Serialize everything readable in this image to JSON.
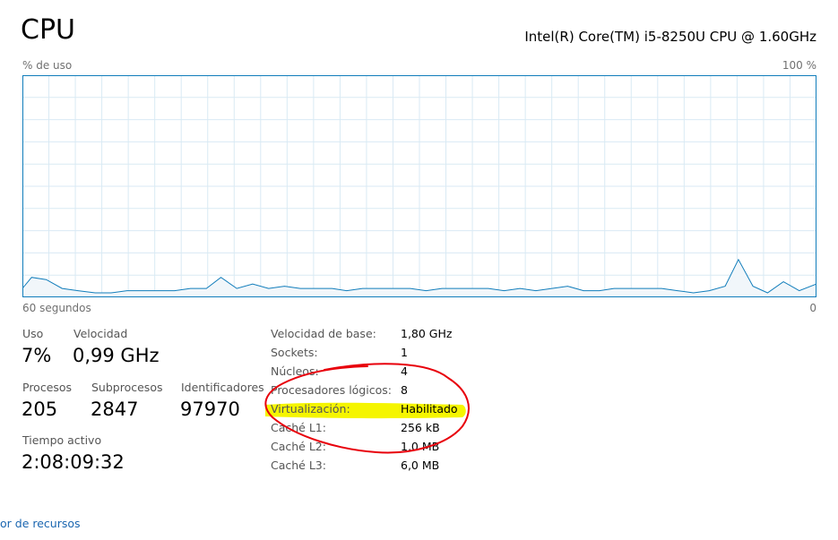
{
  "header": {
    "title": "CPU",
    "cpu_model": "Intel(R) Core(TM) i5-8250U CPU @ 1.60GHz"
  },
  "graph": {
    "y_label": "% de uso",
    "y_max_label": "100 %",
    "x_left_label": "60 segundos",
    "x_right_label": "0",
    "line_color": "#117dbb",
    "grid_color": "#d9eaf4",
    "fill_color": "#f1f6fa"
  },
  "chart_data": {
    "type": "area",
    "x_unit": "seconds",
    "xlim": [
      60,
      0
    ],
    "ylim": [
      0,
      100
    ],
    "grid": true,
    "x": [
      60,
      59.3,
      58.2,
      57.0,
      55.8,
      54.5,
      53.3,
      52.1,
      50.9,
      49.7,
      48.5,
      47.3,
      46.1,
      45.0,
      43.8,
      42.6,
      41.4,
      40.2,
      39.0,
      37.8,
      36.6,
      35.5,
      34.3,
      33.1,
      31.9,
      30.7,
      29.5,
      28.3,
      27.1,
      26.0,
      24.8,
      23.6,
      22.4,
      21.2,
      20.0,
      18.8,
      17.6,
      16.4,
      15.3,
      14.1,
      12.9,
      11.7,
      10.5,
      9.3,
      8.1,
      6.9,
      5.9,
      4.8,
      3.7,
      2.5,
      1.3,
      0
    ],
    "values": [
      4,
      9,
      8,
      4,
      3,
      2,
      2,
      3,
      3,
      3,
      3,
      4,
      4,
      9,
      4,
      6,
      4,
      5,
      4,
      4,
      4,
      3,
      4,
      4,
      4,
      4,
      3,
      4,
      4,
      4,
      4,
      3,
      4,
      3,
      4,
      5,
      3,
      3,
      4,
      4,
      4,
      4,
      3,
      2,
      3,
      5,
      17,
      5,
      2,
      7,
      3,
      6
    ]
  },
  "stats": {
    "uso_label": "Uso",
    "uso_value": "7%",
    "velocidad_label": "Velocidad",
    "velocidad_value": "0,99 GHz",
    "procesos_label": "Procesos",
    "procesos_value": "205",
    "subprocesos_label": "Subprocesos",
    "subprocesos_value": "2847",
    "identificadores_label": "Identificadores",
    "identificadores_value": "97970",
    "tiempo_label": "Tiempo activo",
    "tiempo_value": "2:08:09:32"
  },
  "details": [
    {
      "label": "Velocidad de base:",
      "value": "1,80 GHz"
    },
    {
      "label": "Sockets:",
      "value": "1"
    },
    {
      "label": "Núcleos:",
      "value": "4"
    },
    {
      "label": "Procesadores lógicos:",
      "value": "8"
    },
    {
      "label": "Virtualización:",
      "value": "Habilitado"
    },
    {
      "label": "Caché L1:",
      "value": "256 kB"
    },
    {
      "label": "Caché L2:",
      "value": "1,0 MB"
    },
    {
      "label": "Caché L3:",
      "value": "6,0 MB"
    }
  ],
  "footer": {
    "resource_monitor_link": "or de recursos"
  },
  "annotations": {
    "highlight_color": "#f5f500",
    "circle_color": "#e8000b"
  }
}
